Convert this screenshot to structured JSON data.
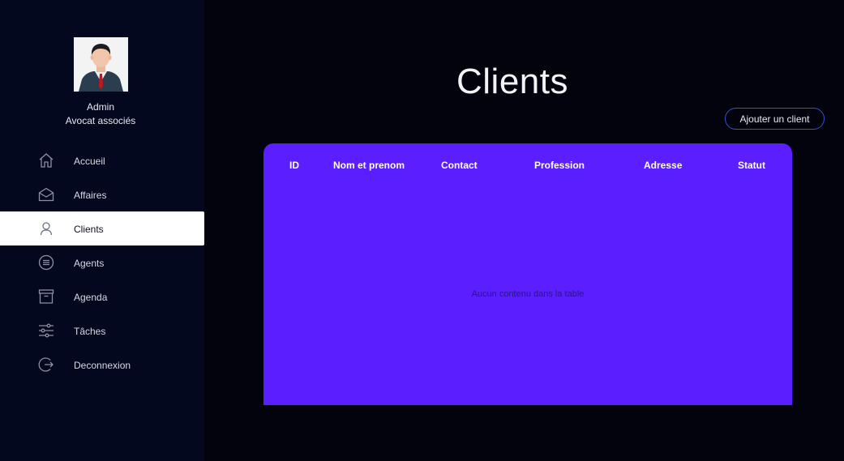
{
  "user": {
    "name": "Admin",
    "role": "Avocat associés"
  },
  "sidebar": {
    "items": [
      {
        "label": "Accueil",
        "icon": "home-icon",
        "active": false
      },
      {
        "label": "Affaires",
        "icon": "envelope-icon",
        "active": false
      },
      {
        "label": "Clients",
        "icon": "user-icon",
        "active": true
      },
      {
        "label": "Agents",
        "icon": "list-circle-icon",
        "active": false
      },
      {
        "label": "Agenda",
        "icon": "archive-icon",
        "active": false
      },
      {
        "label": "Tâches",
        "icon": "sliders-icon",
        "active": false
      },
      {
        "label": "Deconnexion",
        "icon": "logout-icon",
        "active": false
      }
    ]
  },
  "main": {
    "title": "Clients",
    "add_button_label": "Ajouter un client",
    "table": {
      "columns": [
        "ID",
        "Nom et prenom",
        "Contact",
        "Profession",
        "Adresse",
        "Statut"
      ],
      "rows": [],
      "empty_message": "Aucun contenu dans la table"
    }
  },
  "colors": {
    "background": "#02030c",
    "sidebar": "#04081f",
    "table_header": "#5b1eff",
    "button_border": "#3b4fd6"
  }
}
